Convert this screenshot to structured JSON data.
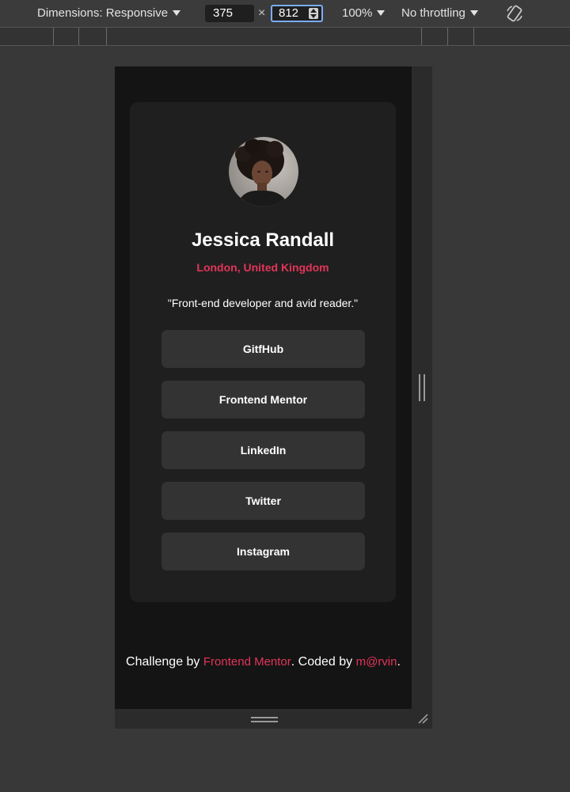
{
  "devtools": {
    "dimensions_label": "Dimensions: Responsive",
    "width_value": "375",
    "times_symbol": "×",
    "height_value": "812",
    "zoom_label": "100%",
    "throttling_label": "No throttling",
    "rotate_icon": "rotate-icon"
  },
  "profile": {
    "avatar_icon": "avatar-photo",
    "name": "Jessica Randall",
    "location": "London, United Kingdom",
    "bio": "\"Front-end developer and avid reader.\"",
    "links": [
      "GitfHub",
      "Frontend Mentor",
      "LinkedIn",
      "Twitter",
      "Instagram"
    ]
  },
  "footer": {
    "prefix": "Challenge by ",
    "challenge_link": "Frontend Mentor",
    "middle": ". Coded by ",
    "author_link": "m@rvin",
    "suffix": "."
  },
  "colors": {
    "accent": "#e3345a",
    "page_bg": "#141414",
    "card_bg": "#1f1f1f",
    "button_bg": "#333333"
  }
}
